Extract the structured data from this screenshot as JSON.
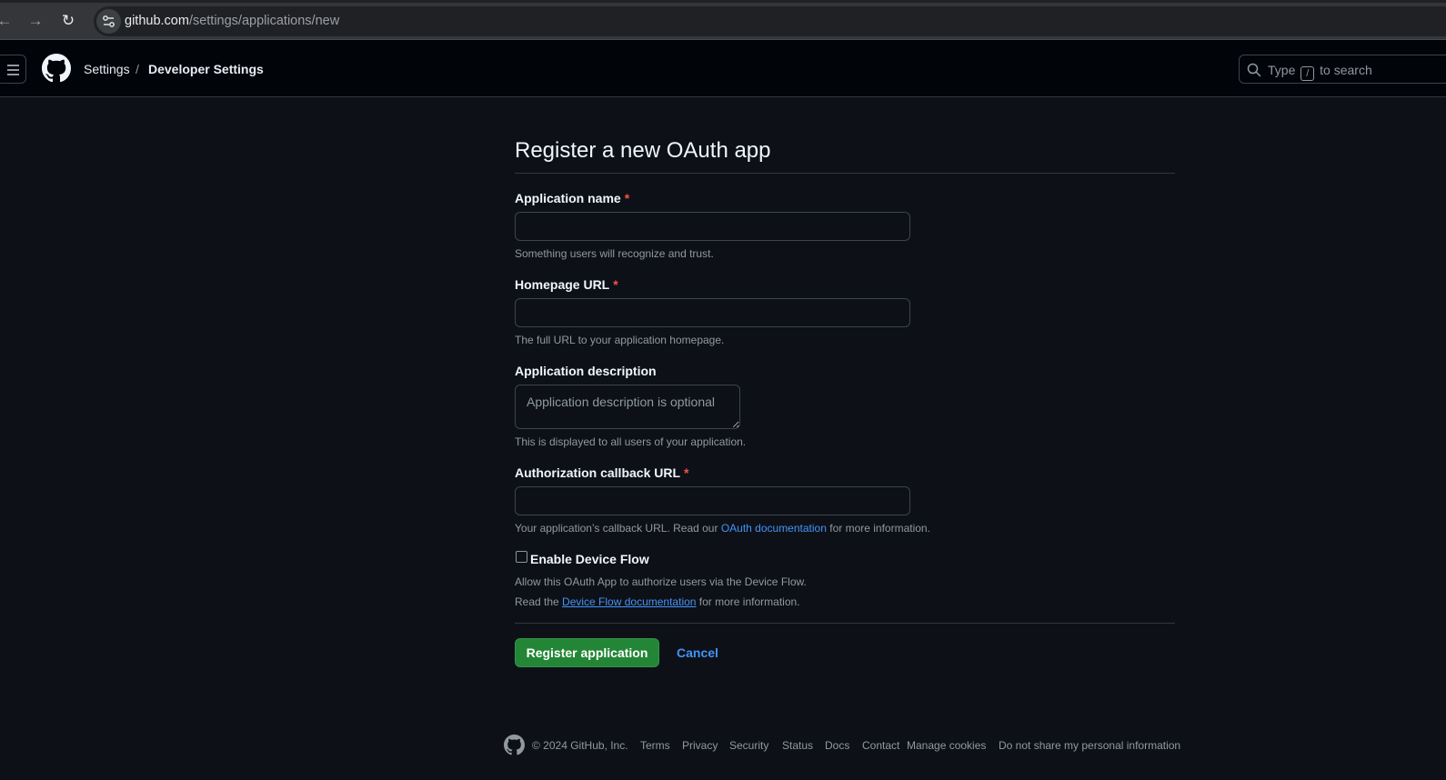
{
  "browser": {
    "url_domain": "github.com",
    "url_path": "/settings/applications/new",
    "back_icon": "arrow-left-icon",
    "forward_icon": "arrow-right-icon",
    "reload_icon": "reload-icon"
  },
  "header": {
    "breadcrumb_settings": "Settings",
    "breadcrumb_separator": "/",
    "breadcrumb_current": "Developer Settings",
    "search_prefix": "Type",
    "search_key": "/",
    "search_suffix": "to search"
  },
  "form": {
    "title": "Register a new OAuth app",
    "required_marker": "*",
    "app_name": {
      "label": "Application name",
      "value": "",
      "note": "Something users will recognize and trust."
    },
    "homepage_url": {
      "label": "Homepage URL",
      "value": "",
      "note": "The full URL to your application homepage."
    },
    "app_description": {
      "label": "Application description",
      "placeholder": "Application description is optional",
      "note": "This is displayed to all users of your application."
    },
    "callback_url": {
      "label": "Authorization callback URL",
      "value": "",
      "note_prefix": "Your application’s callback URL. Read our",
      "note_link": "OAuth documentation",
      "note_suffix": "for more information."
    },
    "device_flow": {
      "label": "Enable Device Flow",
      "checked": false,
      "note_line1": "Allow this OAuth App to authorize users via the Device Flow.",
      "note_prefix": "Read the",
      "note_link": "Device Flow documentation",
      "note_suffix": "for more information."
    },
    "submit_label": "Register application",
    "cancel_label": "Cancel"
  },
  "footer": {
    "copyright": "© 2024 GitHub, Inc.",
    "links": [
      "Terms",
      "Privacy",
      "Security",
      "Status",
      "Docs",
      "Contact",
      "Manage cookies",
      "Do not share my personal information"
    ]
  },
  "colors": {
    "page_bg": "#0d1117",
    "header_bg": "#010409",
    "accent_link": "#4493f8",
    "primary_button": "#238636",
    "required": "#f85149"
  }
}
